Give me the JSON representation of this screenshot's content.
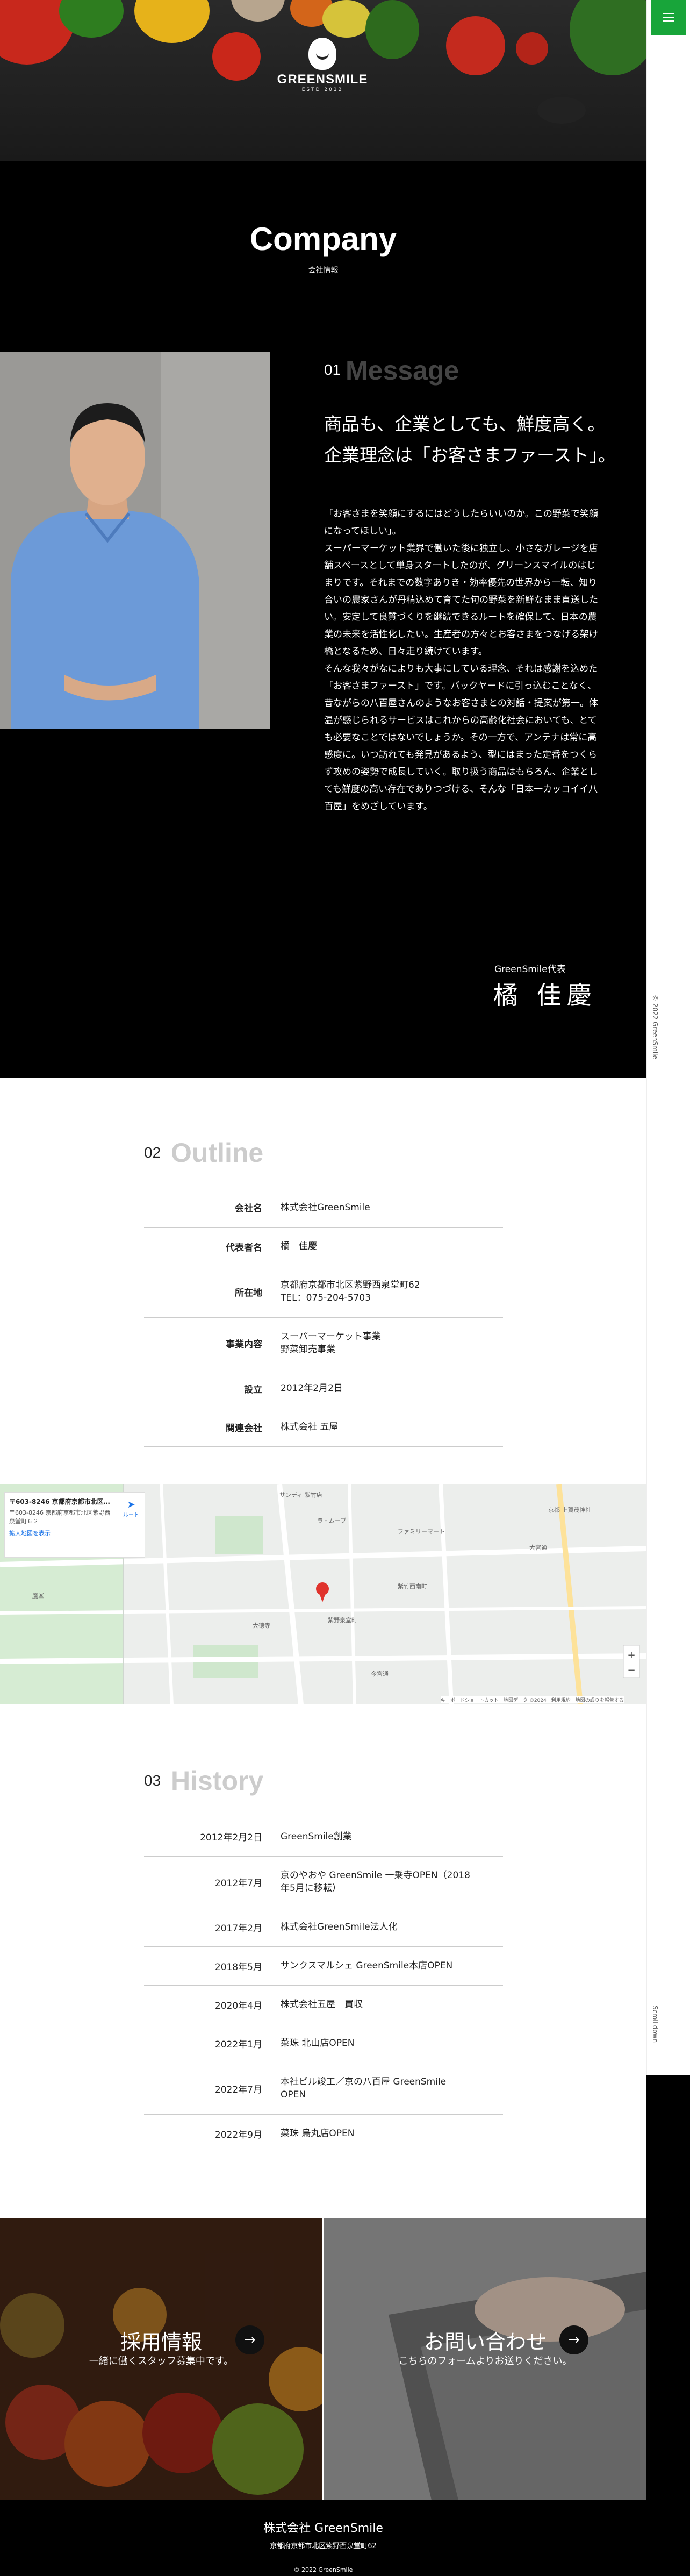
{
  "brand": {
    "name": "GREENSMILE",
    "est": "ESTD 2012"
  },
  "company": {
    "title": "Company",
    "subtitle": "会社情報"
  },
  "message": {
    "num": "01",
    "heading": "Message",
    "catch": "商品も、企業としても、鮮度高く。\n企業理念は「お客さまファースト」。",
    "paragraphs": [
      "「お客さまを笑顔にするにはどうしたらいいのか。この野菜で笑顔になってほしい」。",
      "スーパーマーケット業界で働いた後に独立し、小さなガレージを店舗スペースとして単身スタートしたのが、グリーンスマイルのはじまりです。それまでの数字ありき・効率優先の世界から一転、知り合いの農家さんが丹精込めて育てた旬の野菜を新鮮なまま直送したい。安定して良質づくりを継続できるルートを確保して、日本の農業の未来を活性化したい。生産者の方々とお客さまをつなげる架け橋となるため、日々走り続けています。",
      "そんな我々がなによりも大事にしている理念、それは感謝を込めた「お客さまファースト」です。バックヤードに引っ込むことなく、昔ながらの八百屋さんのようなお客さまとの対話・提案が第一。体温が感じられるサービスはこれからの高齢化社会においても、とても必要なことではないでしょうか。その一方で、アンテナは常に高感度に。いつ訪れても発見があるよう、型にはまった定番をつくらず攻めの姿勢で成長していく。取り扱う商品はもちろん、企業としても鮮度の高い存在でありつづける、そんな「日本一カッコイイ八百屋」をめざしています。"
    ],
    "signature_title": "GreenSmile代表",
    "signature_name": "橘 佳慶"
  },
  "outline": {
    "num": "02",
    "heading": "Outline",
    "rows": [
      {
        "label": "会社名",
        "value": "株式会社GreenSmile"
      },
      {
        "label": "代表者名",
        "value": "橘　佳慶"
      },
      {
        "label": "所在地",
        "value": "京都府京都市北区紫野西泉堂町62\nTEL：075-204-5703"
      },
      {
        "label": "事業内容",
        "value": "スーパーマーケット事業\n野菜卸売事業"
      },
      {
        "label": "設立",
        "value": "2012年2月2日"
      },
      {
        "label": "関連会社",
        "value": "株式会社 五屋"
      }
    ]
  },
  "map": {
    "address_title": "〒603-8246 京都府京都市北区…",
    "address_detail": "〒603-8246 京都府京都市北区紫野西泉堂町６２",
    "enlarge_link": "拡大地図を表示",
    "route_label": "ルート",
    "attribution": "キーボードショートカット　地図データ ©2024　利用規約　地図の誤りを報告する",
    "place_labels": [
      "サンディ 紫竹店",
      "ラ・ムーブ",
      "大徳寺",
      "紫竹西南町",
      "今宮通",
      "鷹峯",
      "紫野泉堂町",
      "大宮通",
      "ファミリーマート",
      "京都 上賀茂神社"
    ]
  },
  "history": {
    "num": "03",
    "heading": "History",
    "rows": [
      {
        "date": "2012年2月2日",
        "event": "GreenSmile創業"
      },
      {
        "date": "2012年7月",
        "event": "京のやおや GreenSmile 一乗寺OPEN（2018年5月に移転）"
      },
      {
        "date": "2017年2月",
        "event": "株式会社GreenSmile法人化"
      },
      {
        "date": "2018年5月",
        "event": "サンクスマルシェ GreenSmile本店OPEN"
      },
      {
        "date": "2020年4月",
        "event": "株式会社五屋　買収"
      },
      {
        "date": "2022年1月",
        "event": "菜珠 北山店OPEN"
      },
      {
        "date": "2022年7月",
        "event": "本社ビル竣工／京の八百屋 GreenSmile OPEN"
      },
      {
        "date": "2022年9月",
        "event": "菜珠 烏丸店OPEN"
      }
    ]
  },
  "banners": [
    {
      "title": "採用情報",
      "sub": "一緒に働くスタッフ募集中です。",
      "arrow": "→"
    },
    {
      "title": "お問い合わせ",
      "sub": "こちらのフォームよりお送りください。",
      "arrow": "→"
    }
  ],
  "footer": {
    "company": "株式会社 GreenSmile",
    "address": "京都府京都市北区紫野西泉堂町62",
    "copyright": "© 2022 GreenSmile"
  },
  "rail": {
    "copyright": "© 2022 GreenSmile",
    "scroll": "Scroll down"
  },
  "colors": {
    "accent": "#18a53a",
    "black": "#000000"
  }
}
